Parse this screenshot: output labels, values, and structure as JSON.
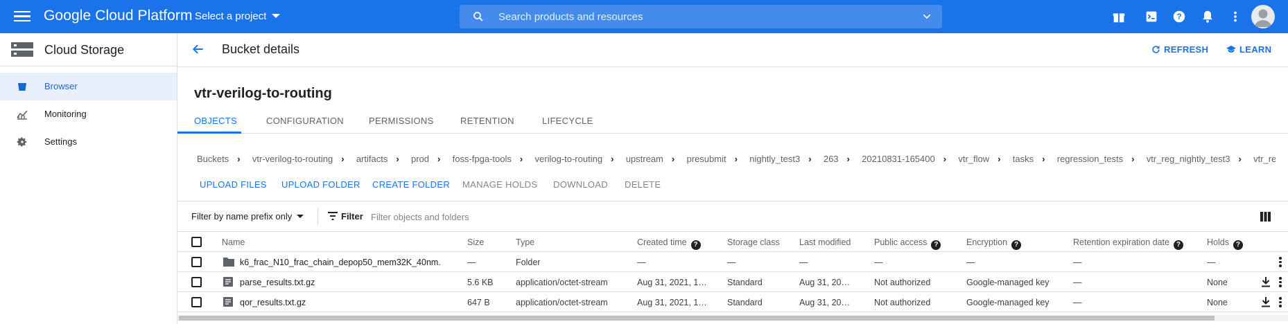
{
  "topbar": {
    "brand": "Google Cloud Platform",
    "project_selector": "Select a project",
    "search_placeholder": "Search products and resources",
    "icons": [
      "gift-icon",
      "cloud-shell-icon",
      "help-icon",
      "notifications-icon",
      "more-vert-icon",
      "account-avatar"
    ]
  },
  "leftnav": {
    "product": "Cloud Storage",
    "items": [
      {
        "label": "Browser",
        "icon": "bucket-icon",
        "active": true
      },
      {
        "label": "Monitoring",
        "icon": "chart-icon",
        "active": false
      },
      {
        "label": "Settings",
        "icon": "gear-icon",
        "active": false
      }
    ]
  },
  "header": {
    "title": "Bucket details",
    "refresh": "REFRESH",
    "learn": "LEARN"
  },
  "bucket": {
    "name": "vtr-verilog-to-routing"
  },
  "tabs": [
    "OBJECTS",
    "CONFIGURATION",
    "PERMISSIONS",
    "RETENTION",
    "LIFECYCLE"
  ],
  "breadcrumbs": [
    "Buckets",
    "vtr-verilog-to-routing",
    "artifacts",
    "prod",
    "foss-fpga-tools",
    "verilog-to-routing",
    "upstream",
    "presubmit",
    "nightly_test3",
    "263",
    "20210831-165400",
    "vtr_flow",
    "tasks",
    "regression_tests",
    "vtr_reg_nightly_test3",
    "vtr_reg_qor_chain_dep"
  ],
  "actions": [
    {
      "label": "UPLOAD FILES",
      "enabled": true
    },
    {
      "label": "UPLOAD FOLDER",
      "enabled": true
    },
    {
      "label": "CREATE FOLDER",
      "enabled": true
    },
    {
      "label": "MANAGE HOLDS",
      "enabled": false
    },
    {
      "label": "DOWNLOAD",
      "enabled": false
    },
    {
      "label": "DELETE",
      "enabled": false
    }
  ],
  "filter": {
    "mode": "Filter by name prefix only",
    "label": "Filter",
    "placeholder": "Filter objects and folders"
  },
  "table": {
    "columns": [
      "Name",
      "Size",
      "Type",
      "Created time",
      "Storage class",
      "Last modified",
      "Public access",
      "Encryption",
      "Retention expiration date",
      "Holds"
    ],
    "rows": [
      {
        "name": "k6_frac_N10_frac_chain_depop50_mem32K_40nm.",
        "size": "—",
        "type": "Folder",
        "created": "—",
        "storage": "—",
        "modified": "—",
        "public": "—",
        "encryption": "—",
        "retention": "—",
        "holds": "—",
        "kind": "folder"
      },
      {
        "name": "parse_results.txt.gz",
        "size": "5.6 KB",
        "type": "application/octet-stream",
        "created": "Aug 31, 2021, 1…",
        "storage": "Standard",
        "modified": "Aug 31, 20…",
        "public": "Not authorized",
        "encryption": "Google-managed key",
        "retention": "—",
        "holds": "None",
        "kind": "file"
      },
      {
        "name": "qor_results.txt.gz",
        "size": "647 B",
        "type": "application/octet-stream",
        "created": "Aug 31, 2021, 1…",
        "storage": "Standard",
        "modified": "Aug 31, 20…",
        "public": "Not authorized",
        "encryption": "Google-managed key",
        "retention": "—",
        "holds": "None",
        "kind": "file"
      }
    ]
  },
  "colors": {
    "topbar": "#1a73e8",
    "accent": "#1a73e8",
    "active_nav_bg": "#e8f0fe"
  }
}
